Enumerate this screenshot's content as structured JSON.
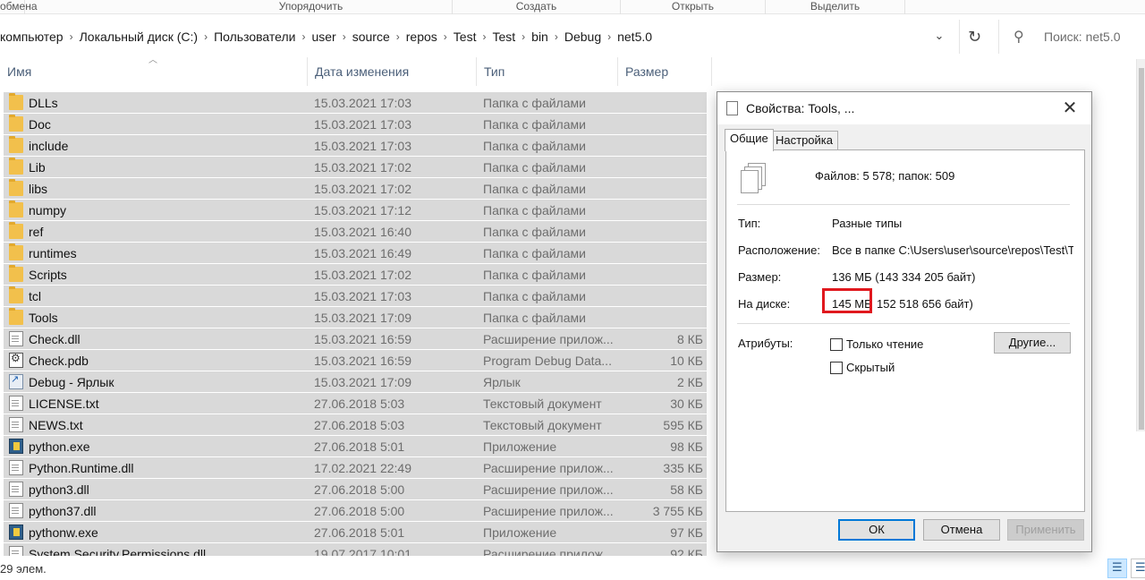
{
  "ribbon": {
    "groups": [
      "обмена",
      "Упорядочить",
      "Создать",
      "Открыть",
      "Выделить"
    ]
  },
  "address": {
    "crumbs": [
      "компьютер",
      "Локальный диск (C:)",
      "Пользователи",
      "user",
      "source",
      "repos",
      "Test",
      "Test",
      "bin",
      "Debug",
      "net5.0"
    ],
    "search_placeholder": "Поиск: net5.0",
    "refresh_icon": "refresh-icon",
    "search_icon": "search-icon"
  },
  "columns": {
    "name": "Имя",
    "date": "Дата изменения",
    "type": "Тип",
    "size": "Размер"
  },
  "files": [
    {
      "name": "DLLs",
      "date": "15.03.2021 17:03",
      "type": "Папка с файлами",
      "size": "",
      "icon": "folder"
    },
    {
      "name": "Doc",
      "date": "15.03.2021 17:03",
      "type": "Папка с файлами",
      "size": "",
      "icon": "folder"
    },
    {
      "name": "include",
      "date": "15.03.2021 17:03",
      "type": "Папка с файлами",
      "size": "",
      "icon": "folder"
    },
    {
      "name": "Lib",
      "date": "15.03.2021 17:02",
      "type": "Папка с файлами",
      "size": "",
      "icon": "folder"
    },
    {
      "name": "libs",
      "date": "15.03.2021 17:02",
      "type": "Папка с файлами",
      "size": "",
      "icon": "folder"
    },
    {
      "name": "numpy",
      "date": "15.03.2021 17:12",
      "type": "Папка с файлами",
      "size": "",
      "icon": "folder"
    },
    {
      "name": "ref",
      "date": "15.03.2021 16:40",
      "type": "Папка с файлами",
      "size": "",
      "icon": "folder"
    },
    {
      "name": "runtimes",
      "date": "15.03.2021 16:49",
      "type": "Папка с файлами",
      "size": "",
      "icon": "folder"
    },
    {
      "name": "Scripts",
      "date": "15.03.2021 17:02",
      "type": "Папка с файлами",
      "size": "",
      "icon": "folder"
    },
    {
      "name": "tcl",
      "date": "15.03.2021 17:03",
      "type": "Папка с файлами",
      "size": "",
      "icon": "folder"
    },
    {
      "name": "Tools",
      "date": "15.03.2021 17:09",
      "type": "Папка с файлами",
      "size": "",
      "icon": "folder"
    },
    {
      "name": "Check.dll",
      "date": "15.03.2021 16:59",
      "type": "Расширение прилож...",
      "size": "8 КБ",
      "icon": "file"
    },
    {
      "name": "Check.pdb",
      "date": "15.03.2021 16:59",
      "type": "Program Debug Data...",
      "size": "10 КБ",
      "icon": "pdb"
    },
    {
      "name": "Debug - Ярлык",
      "date": "15.03.2021 17:09",
      "type": "Ярлык",
      "size": "2 КБ",
      "icon": "shortcut"
    },
    {
      "name": "LICENSE.txt",
      "date": "27.06.2018 5:03",
      "type": "Текстовый документ",
      "size": "30 КБ",
      "icon": "file"
    },
    {
      "name": "NEWS.txt",
      "date": "27.06.2018 5:03",
      "type": "Текстовый документ",
      "size": "595 КБ",
      "icon": "file"
    },
    {
      "name": "python.exe",
      "date": "27.06.2018 5:01",
      "type": "Приложение",
      "size": "98 КБ",
      "icon": "python"
    },
    {
      "name": "Python.Runtime.dll",
      "date": "17.02.2021 22:49",
      "type": "Расширение прилож...",
      "size": "335 КБ",
      "icon": "file"
    },
    {
      "name": "python3.dll",
      "date": "27.06.2018 5:00",
      "type": "Расширение прилож...",
      "size": "58 КБ",
      "icon": "file"
    },
    {
      "name": "python37.dll",
      "date": "27.06.2018 5:00",
      "type": "Расширение прилож...",
      "size": "3 755 КБ",
      "icon": "file"
    },
    {
      "name": "pythonw.exe",
      "date": "27.06.2018 5:01",
      "type": "Приложение",
      "size": "97 КБ",
      "icon": "python"
    },
    {
      "name": "System.Security.Permissions.dll",
      "date": "19.07.2017 10:01",
      "type": "Расширение прилож...",
      "size": "92 КБ",
      "icon": "file"
    }
  ],
  "status": {
    "count": "29 элем."
  },
  "dialog": {
    "title": "Свойства: Tools, ...",
    "tabs": [
      "Общие",
      "Настройка"
    ],
    "summary": "Файлов: 5 578; папок: 509",
    "type_label": "Тип:",
    "type_value": "Разные типы",
    "location_label": "Расположение:",
    "location_value": "Все в папке C:\\Users\\user\\source\\repos\\Test\\Tes",
    "size_label": "Размер:",
    "size_value": "136 МБ (143 334 205 байт)",
    "disk_label": "На диске:",
    "disk_value_highlight": "145 МБ",
    "disk_value_rest": "152 518 656 байт)",
    "attributes_label": "Атрибуты:",
    "readonly_label": "Только чтение",
    "hidden_label": "Скрытый",
    "other_button": "Другие...",
    "ok_button": "ОК",
    "cancel_button": "Отмена",
    "apply_button": "Применить",
    "highlight_color": "#e0181e"
  }
}
